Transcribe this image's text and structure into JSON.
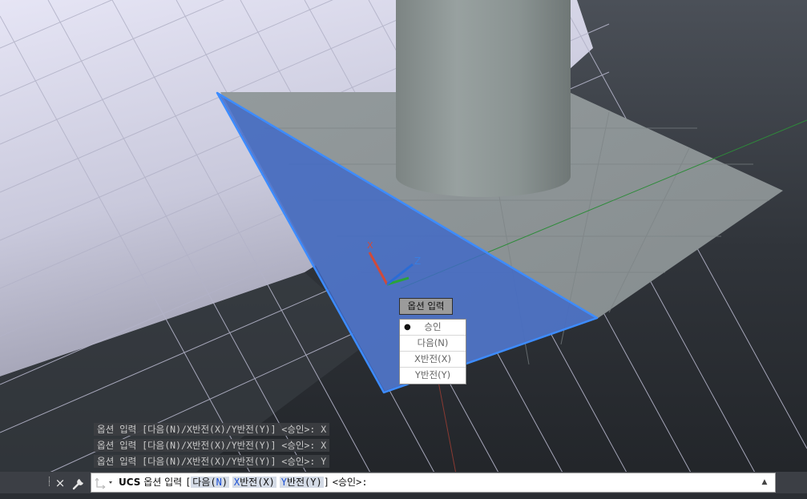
{
  "viewport": {
    "colors": {
      "ground_light": "#e4e3f4",
      "ground_dark": "#24272c",
      "plane": "#8c9396",
      "cylinder": "#8a9392",
      "face_highlight": "#4d72bf",
      "face_edge": "#3d8cff",
      "x_axis": "#d04a3a",
      "y_axis": "#2aa33a",
      "z_axis": "#2a6cd6"
    },
    "axis_labels": {
      "x": "X",
      "z": "Z"
    }
  },
  "context_menu": {
    "header": "옵션 입력",
    "items": [
      {
        "label": "승인",
        "selected": true
      },
      {
        "label": "다음(N)",
        "selected": false
      },
      {
        "label": "X반전(X)",
        "selected": false
      },
      {
        "label": "Y반전(Y)",
        "selected": false
      }
    ]
  },
  "command_history": [
    "옵션 입력 [다음(N)/X반전(X)/Y반전(Y)] <승인>: X",
    "옵션 입력 [다음(N)/X반전(X)/Y반전(Y)] <승인>: X",
    "옵션 입력 [다음(N)/X반전(X)/Y반전(Y)] <승인>: Y"
  ],
  "command_line": {
    "close_symbol": "×",
    "command": "UCS",
    "prompt": "옵션 입력",
    "open_bracket": "[",
    "options": [
      {
        "key": "N",
        "label": "다음(N)"
      },
      {
        "key": "X",
        "label": "X반전(X)"
      },
      {
        "key": "Y",
        "label": "Y반전(Y)"
      }
    ],
    "close_bracket": "]",
    "default": "<승인>:",
    "expand_symbol": "▲"
  }
}
